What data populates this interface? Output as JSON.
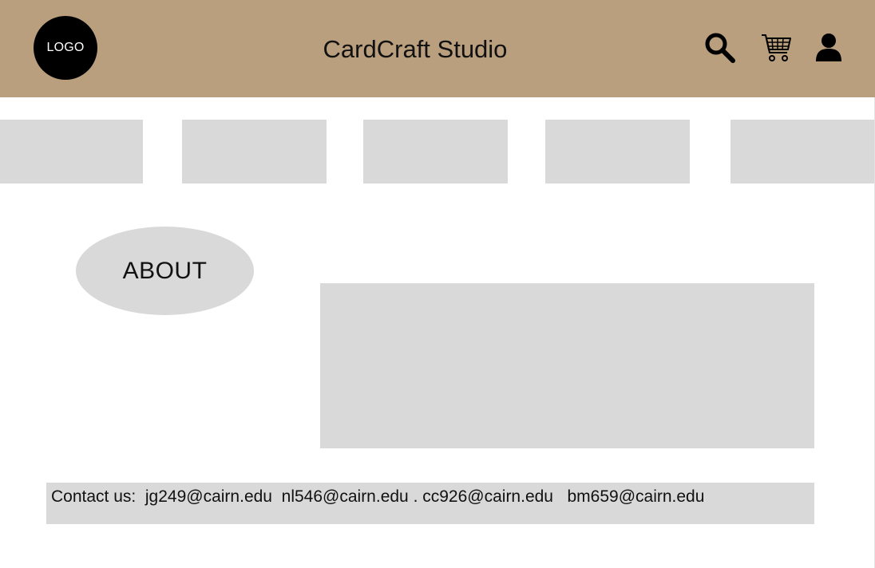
{
  "header": {
    "logo_text": "LOGO",
    "title": "CardCraft Studio",
    "background_color": "#b99f7e",
    "icons": [
      "search-icon",
      "cart-icon",
      "user-icon"
    ]
  },
  "nav": {
    "tiles": [
      "",
      "",
      "",
      "",
      ""
    ],
    "tile_color": "#d9d9d9"
  },
  "about": {
    "label": "ABOUT"
  },
  "contact": {
    "text": "Contact us:  jg249@cairn.edu  nl546@cairn.edu . cc926@cairn.edu   bm659@cairn.edu"
  }
}
